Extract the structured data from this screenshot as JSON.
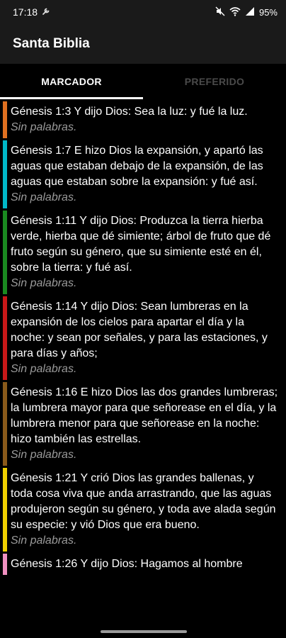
{
  "status_bar": {
    "time": "17:18",
    "battery": "95%",
    "icons": [
      "wrench-icon",
      "mute-icon",
      "wifi-icon",
      "signal-icon",
      "battery-icon"
    ]
  },
  "app": {
    "title": "Santa Biblia"
  },
  "tabs": [
    {
      "label": "MARCADOR",
      "active": true
    },
    {
      "label": "PREFERIDO",
      "active": false
    }
  ],
  "bookmarks": [
    {
      "verse": "Génesis 1:3 Y dijo Dios: Sea la luz: y fué la luz.",
      "note": "Sin palabras.",
      "color": "#e07020"
    },
    {
      "verse": "Génesis 1:7 E hizo Dios la expansión, y apartó las aguas que estaban debajo de la expansión, de las aguas que estaban sobre la expansión: y fué así.",
      "note": "Sin palabras.",
      "color": "#00b8c8"
    },
    {
      "verse": "Génesis 1:11 Y dijo Dios: Produzca la tierra hierba verde, hierba que dé simiente; árbol de fruto que dé fruto según su género, que su simiente esté en él, sobre la tierra: y fué así.",
      "note": "Sin palabras.",
      "color": "#1a8a20"
    },
    {
      "verse": "Génesis 1:14 Y dijo Dios: Sean lumbreras en la expansión de los cielos para apartar el día y la noche: y sean por señales, y para las estaciones, y para días y años;",
      "note": "Sin palabras.",
      "color": "#c81818"
    },
    {
      "verse": "Génesis 1:16 E hizo Dios las dos grandes lumbreras; la lumbrera mayor para que señorease en el día, y la lumbrera menor para que señorease en la noche: hizo también las estrellas.",
      "note": "Sin palabras.",
      "color": "#8a5a1a"
    },
    {
      "verse": "Génesis 1:21 Y crió Dios las grandes ballenas, y toda cosa viva que anda arrastrando, que las aguas produjeron según su género, y toda ave alada según su especie: y vió Dios que era bueno.",
      "note": "Sin palabras.",
      "color": "#f0d000"
    },
    {
      "verse": "Génesis 1:26 Y dijo Dios: Hagamos al hombre",
      "note": "",
      "color": "#f090c0"
    }
  ]
}
